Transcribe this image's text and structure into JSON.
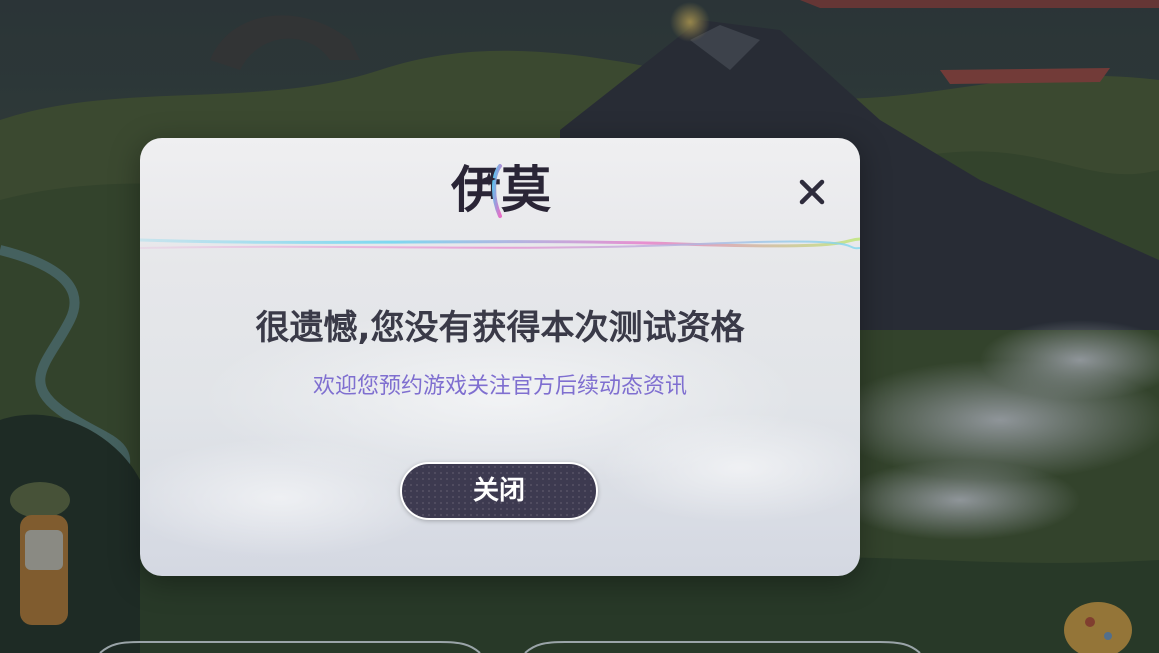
{
  "dialog": {
    "logo_text": "伊莫",
    "close_icon": "close-icon",
    "title": "很遗憾,您没有获得本次测试资格",
    "subtitle": "欢迎您预约游戏关注官方后续动态资讯",
    "close_button_label": "关闭"
  },
  "colors": {
    "title": "#3a3a48",
    "subtitle": "#7f6fd0",
    "button_bg": "#3d3a50",
    "button_text": "#ffffff",
    "logo": "#2a2536",
    "divider_cyan": "#7fd8f0",
    "divider_pink": "#e88fd0"
  }
}
